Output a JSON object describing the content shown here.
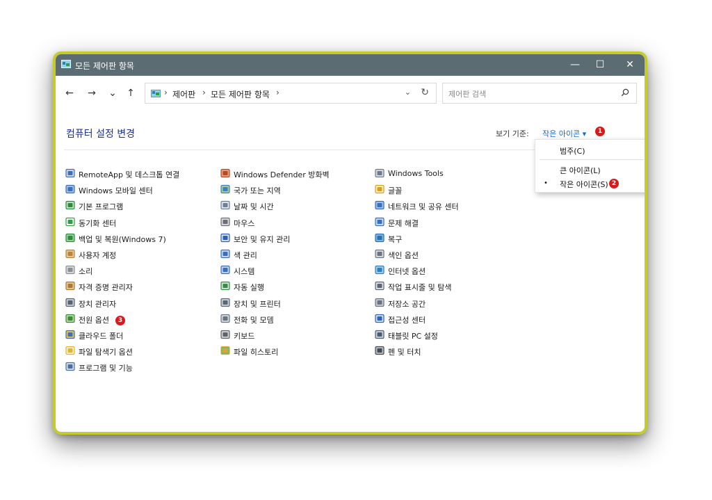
{
  "window": {
    "title": "모든 제어판 항목",
    "minimize_glyph": "—",
    "maximize_glyph": "☐",
    "close_glyph": "✕"
  },
  "nav": {
    "back": "←",
    "forward": "→",
    "recent": "⌄",
    "up": "↑"
  },
  "address": {
    "segments": [
      "제어판",
      "모든 제어판 항목"
    ],
    "separator": "›",
    "dropdown": "⌄",
    "refresh": "↻"
  },
  "search": {
    "placeholder": "제어판 검색",
    "value": ""
  },
  "heading": "컴퓨터 설정 변경",
  "view_by": {
    "label": "보기 기준:",
    "value": "작은 아이콘 ▾"
  },
  "view_menu": {
    "options": [
      "범주(C)",
      "큰 아이콘(L)",
      "작은 아이콘(S)"
    ],
    "selected": "작은 아이콘(S)",
    "bullet": "•"
  },
  "annotations": [
    "1",
    "2",
    "3"
  ],
  "items": {
    "col1": [
      {
        "label": "RemoteApp 및 데스크톱 연결",
        "icon": "remoteapp-icon"
      },
      {
        "label": "Windows 모바일 센터",
        "icon": "mobility-center-icon"
      },
      {
        "label": "기본 프로그램",
        "icon": "default-programs-icon"
      },
      {
        "label": "동기화 센터",
        "icon": "sync-center-icon"
      },
      {
        "label": "백업 및 복원(Windows 7)",
        "icon": "backup-restore-icon"
      },
      {
        "label": "사용자 계정",
        "icon": "user-accounts-icon"
      },
      {
        "label": "소리",
        "icon": "sound-icon"
      },
      {
        "label": "자격 증명 관리자",
        "icon": "credential-manager-icon"
      },
      {
        "label": "장치 관리자",
        "icon": "device-manager-icon"
      },
      {
        "label": "전원 옵션",
        "icon": "power-options-icon"
      },
      {
        "label": "클라우드 폴더",
        "icon": "work-folders-icon"
      },
      {
        "label": "파일 탐색기 옵션",
        "icon": "file-explorer-options-icon"
      },
      {
        "label": "프로그램 및 기능",
        "icon": "programs-features-icon"
      }
    ],
    "col2": [
      {
        "label": "Windows Defender 방화벽",
        "icon": "firewall-icon"
      },
      {
        "label": "국가 또는 지역",
        "icon": "region-icon"
      },
      {
        "label": "날짜 및 시간",
        "icon": "date-time-icon"
      },
      {
        "label": "마우스",
        "icon": "mouse-icon"
      },
      {
        "label": "보안 및 유지 관리",
        "icon": "security-maintenance-icon"
      },
      {
        "label": "색 관리",
        "icon": "color-management-icon"
      },
      {
        "label": "시스템",
        "icon": "system-icon"
      },
      {
        "label": "자동 실행",
        "icon": "autoplay-icon"
      },
      {
        "label": "장치 및 프린터",
        "icon": "devices-printers-icon"
      },
      {
        "label": "전화 및 모뎀",
        "icon": "phone-modem-icon"
      },
      {
        "label": "키보드",
        "icon": "keyboard-icon"
      },
      {
        "label": "파일 히스토리",
        "icon": "file-history-icon"
      }
    ],
    "col3": [
      {
        "label": "Windows Tools",
        "icon": "windows-tools-icon"
      },
      {
        "label": "글꼴",
        "icon": "fonts-icon"
      },
      {
        "label": "네트워크 및 공유 센터",
        "icon": "network-sharing-icon"
      },
      {
        "label": "문제 해결",
        "icon": "troubleshooting-icon"
      },
      {
        "label": "복구",
        "icon": "recovery-icon"
      },
      {
        "label": "색인 옵션",
        "icon": "indexing-options-icon"
      },
      {
        "label": "인터넷 옵션",
        "icon": "internet-options-icon"
      },
      {
        "label": "작업 표시줄 및 탐색",
        "icon": "taskbar-navigation-icon"
      },
      {
        "label": "저장소 공간",
        "icon": "storage-spaces-icon"
      },
      {
        "label": "접근성 센터",
        "icon": "ease-of-access-icon"
      },
      {
        "label": "태블릿 PC 설정",
        "icon": "tablet-pc-settings-icon"
      },
      {
        "label": "펜 및 터치",
        "icon": "pen-touch-icon"
      }
    ]
  },
  "colors": {
    "titlebar": "#5b6d73",
    "frame_highlight": "#c5cc2a",
    "heading": "#1e3287",
    "link": "#1a68c6",
    "badge": "#d9191c"
  }
}
